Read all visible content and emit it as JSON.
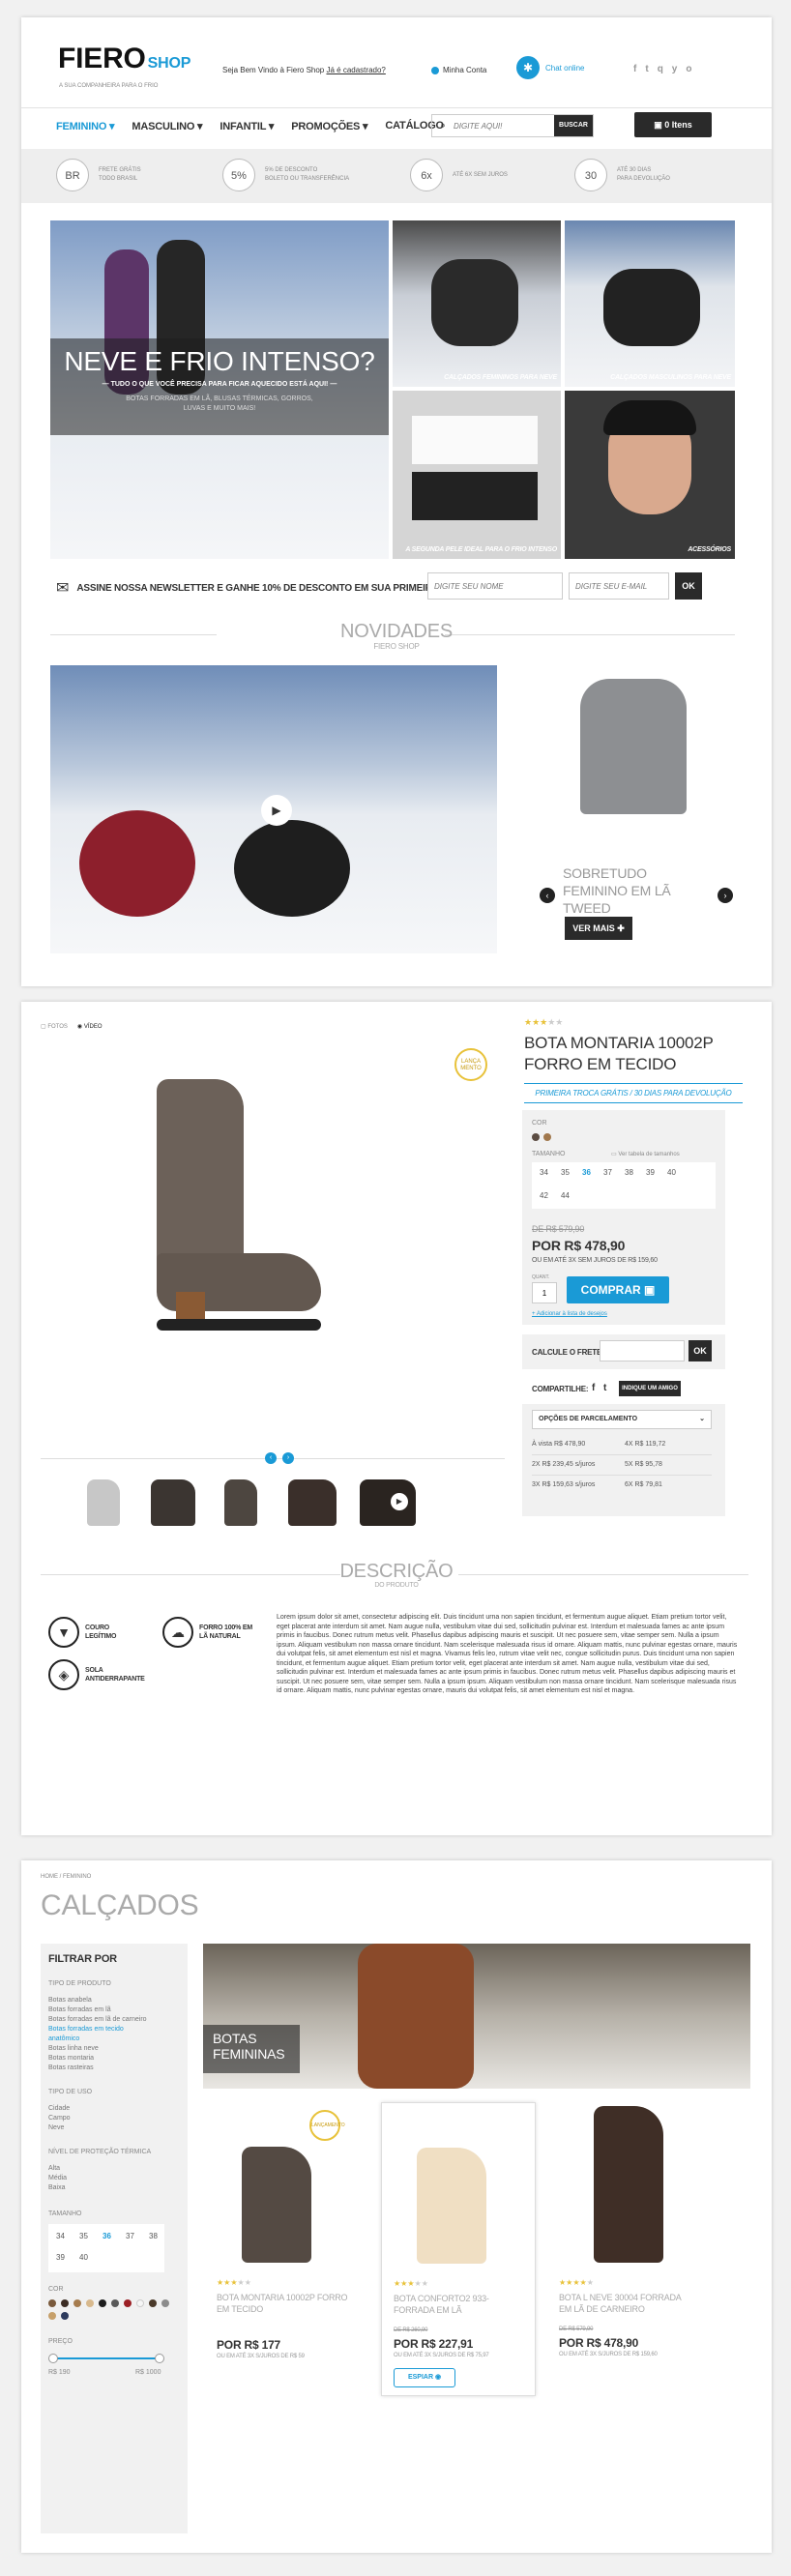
{
  "header": {
    "logo_main": "FIERO",
    "logo_sub": "SHOP",
    "tagline": "A SUA COMPANHEIRA PARA O FRIO",
    "welcome": "Seja Bem Vindo à Fiero Shop",
    "register_link": "Já é cadastrado?",
    "account": "Minha Conta",
    "chat": "Chat online",
    "social": [
      "f",
      "t",
      "q",
      "y",
      "o"
    ]
  },
  "nav": {
    "items": [
      "FEMININO",
      "MASCULINO",
      "INFANTIL",
      "PROMOÇÕES",
      "CATÁLOGO"
    ],
    "search_placeholder": "DIGITE AQUI!",
    "search_button": "BUSCAR",
    "cart": "0 Itens"
  },
  "benefits": [
    {
      "icon": "BR",
      "line1": "FRETE GRÁTIS",
      "line2": "TODO BRASIL"
    },
    {
      "icon": "5%",
      "line1": "5% DE DESCONTO",
      "line2": "BOLETO OU TRANSFERÊNCIA"
    },
    {
      "icon": "6x",
      "line1": "ATÉ 6X SEM JUROS",
      "line2": ""
    },
    {
      "icon": "30",
      "line1": "ATÉ 30 DIAS",
      "line2": "PARA DEVOLUÇÃO"
    }
  ],
  "hero": {
    "title": "NEVE E FRIO INTENSO?",
    "subtitle": "— TUDO O QUE VOCÊ PRECISA PARA FICAR AQUECIDO ESTÁ AQUI! —",
    "text1": "BOTAS FORRADAS EM LÃ, BLUSAS TÉRMICAS, GORROS,",
    "text2": "LUVAS E MUITO MAIS!",
    "tiles": [
      "CALÇADOS FEMININOS PARA NEVE",
      "CALÇADOS MASCULINOS PARA NEVE",
      "A SEGUNDA PELE IDEAL PARA O FRIO INTENSO",
      "ACESSÓRIOS"
    ]
  },
  "newsletter": {
    "text": "ASSINE NOSSA NEWSLETTER E GANHE 10% DE DESCONTO EM SUA PRIMEIRA COMPRA",
    "name_placeholder": "DIGITE SEU NOME",
    "email_placeholder": "DIGITE SEU E-MAIL",
    "button": "OK"
  },
  "novidades": {
    "title": "NOVIDADES",
    "sub": "FIERO SHOP",
    "product": "SOBRETUDO FEMININO EM LÃ TWEED",
    "button": "VER MAIS"
  },
  "product": {
    "tab_photo": "FOTOS",
    "tab_video": "VÍDEO",
    "badge1": "LANÇA",
    "badge2": "MENTO",
    "name": "BOTA MONTARIA 10002P FORRO EM TECIDO",
    "promo": "PRIMEIRA TROCA GRÁTIS / 30 DIAS PARA DEVOLUÇÃO",
    "color_label": "COR",
    "size_label": "TAMANHO",
    "size_table": "Ver tabela de tamanhos",
    "sizes": [
      "34",
      "35",
      "36",
      "37",
      "38",
      "39",
      "40",
      "42",
      "44"
    ],
    "old_price": "DE R$ 579,90",
    "price": "POR R$ 478,90",
    "installments": "OU EM ATÉ 3X SEM JUROS DE R$ 159,60",
    "qty_label": "QUANT.",
    "qty": "1",
    "buy": "COMPRAR",
    "wishlist": "+ Adicionar à lista de desejos",
    "shipping_label": "CALCULE O FRETE:",
    "shipping_btn": "OK",
    "share_label": "COMPARTILHE:",
    "share_buttons": [
      "f",
      "t"
    ],
    "indicate": "INDIQUE UM AMIGO",
    "installments_title": "OPÇÕES DE PARCELAMENTO",
    "installments_table": [
      [
        "À vista R$ 478,90",
        "4X R$ 119,72"
      ],
      [
        "2X R$ 239,45 s/juros",
        "5X R$ 95,78"
      ],
      [
        "3X R$ 159,63 s/juros",
        "6X R$ 79,81"
      ]
    ],
    "desc_title": "DESCRIÇÃO",
    "desc_sub": "DO PRODUTO",
    "features": [
      "COURO LEGÍTIMO",
      "FORRO 100% EM LÃ NATURAL",
      "SOLA ANTIDERRAPANTE"
    ],
    "description": "Lorem ipsum dolor sit amet, consectetur adipiscing elit. Duis tincidunt urna non sapien tincidunt, et fermentum augue aliquet. Etiam pretium tortor velit, eget placerat ante interdum sit amet. Nam augue nulla, vestibulum vitae dui sed, sollicitudin pulvinar est. Interdum et malesuada fames ac ante ipsum primis in faucibus. Donec rutrum metus velit. Phasellus dapibus adipiscing mauris et suscipit. Ut nec posuere sem, vitae semper sem. Nulla a ipsum ipsum. Aliquam vestibulum non massa ornare tincidunt. Nam scelerisque malesuada risus id ornare. Aliquam mattis, nunc pulvinar egestas ornare, mauris dui volutpat felis, sit amet elementum est nisl et magna. Vivamus felis leo, rutrum vitae velit nec, congue sollicitudin purus. Duis tincidunt urna non sapien tincidunt, et fermentum augue aliquet. Etiam pretium tortor velit, eget placerat ante interdum sit amet. Nam augue nulla, vestibulum vitae dui sed, sollicitudin pulvinar est. Interdum et malesuada fames ac ante ipsum primis in faucibus. Donec rutrum metus velit. Phasellus dapibus adipiscing mauris et suscipit. Ut nec posuere sem, vitae semper sem. Nulla a ipsum ipsum. Aliquam vestibulum non massa ornare tincidunt. Nam scelerisque malesuada risus id ornare. Aliquam mattis, nunc pulvinar egestas ornare, mauris dui volutpat felis, sit amet elementum est nisl et magna."
  },
  "category": {
    "breadcrumb": "HOME / FEMININO",
    "title": "CALÇADOS",
    "filter_title": "FILTRAR POR",
    "groups": [
      {
        "title": "TIPO DE PRODUTO",
        "items": [
          "Botas anabela",
          "Botas forradas em lã",
          "Botas forradas em lã de carneiro",
          "Botas forradas em tecido anatômico",
          "Botas linha neve",
          "Botas montaria",
          "Botas rasteiras"
        ]
      },
      {
        "title": "TIPO DE USO",
        "items": [
          "Cidade",
          "Campo",
          "Neve"
        ]
      },
      {
        "title": "NÍVEL DE PROTEÇÃO TÉRMICA",
        "items": [
          "Alta",
          "Média",
          "Baixa"
        ]
      }
    ],
    "size_title": "TAMANHO",
    "sizes": [
      "34",
      "35",
      "36",
      "37",
      "38",
      "39",
      "40"
    ],
    "color_title": "COR",
    "price_title": "PREÇO",
    "price_min": "R$ 190",
    "price_max": "R$ 1000",
    "banner1": "BOTAS",
    "banner2": "FEMININAS",
    "products": [
      {
        "name": "BOTA MONTARIA 10002P FORRO EM TECIDO",
        "old": "",
        "price": "POR R$ 177",
        "inst": "OU EM ATÉ 3X S/JUROS DE R$ 59",
        "badge": "LANÇAMENTO"
      },
      {
        "name": "BOTA CONFORTO2 933-FORRADA EM LÃ",
        "old": "DE R$ 260,90",
        "price": "POR R$ 227,91",
        "inst": "OU EM ATÉ 3X S/JUROS DE R$ 75,97",
        "badge": "",
        "button": "ESPIAR"
      },
      {
        "name": "BOTA L NEVE 30004 FORRADA EM LÃ DE CARNEIRO",
        "old": "DE R$ 579,90",
        "price": "POR R$ 478,90",
        "inst": "OU EM ATÉ 3X S/JUROS DE R$ 159,60",
        "badge": ""
      }
    ]
  },
  "colors": {
    "accent": "#1a9ad6",
    "dark": "#2a2a2a",
    "gold": "#e8c23a"
  }
}
